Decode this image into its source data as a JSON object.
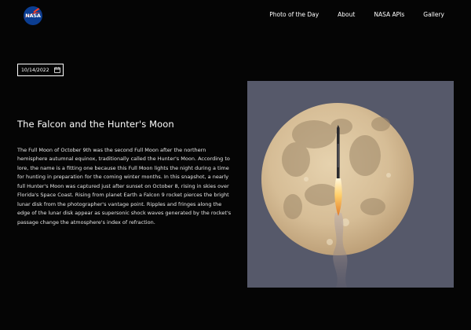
{
  "header": {
    "logo_text": "NASA",
    "nav": [
      {
        "label": "Photo of the Day"
      },
      {
        "label": "About"
      },
      {
        "label": "NASA APIs"
      },
      {
        "label": "Gallery"
      }
    ]
  },
  "date_picker": {
    "value": "10/14/2022"
  },
  "apod": {
    "title": "The Falcon and the Hunter's Moon",
    "explanation": "The Full Moon of October 9th was the second Full Moon after the northern hemisphere autumnal equinox, traditionally called the Hunter's Moon. According to lore, the name is a fitting one because this Full Moon lights the night during a time for hunting in preparation for the coming winter months. In this snapshot, a nearly full Hunter's Moon was captured just after sunset on October 8, rising in skies over Florida's Space Coast. Rising from planet Earth a Falcon 9 rocket pierces the bright lunar disk from the photographer's vantage point. Ripples and fringes along the edge of the lunar disk appear as supersonic shock waves generated by the rocket's passage change the atmosphere's index of refraction."
  },
  "colors": {
    "background": "#050505",
    "text": "#ffffff",
    "nasa_blue": "#0b3d91",
    "nasa_red": "#fc3d21",
    "sky": "#56596a",
    "moon": "#d8c2a0"
  },
  "icons": {
    "logo": "nasa-meatball-icon",
    "date": "calendar-icon"
  }
}
